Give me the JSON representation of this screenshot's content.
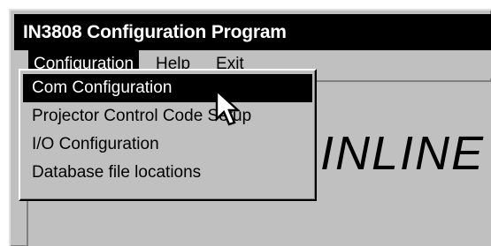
{
  "window": {
    "title": "IN3808 Configuration Program"
  },
  "menubar": {
    "items": [
      {
        "label": "Configuration",
        "accel": "C",
        "rest": "onfiguration"
      },
      {
        "label": "Help",
        "accel": "H",
        "rest": "elp"
      },
      {
        "label": "Exit",
        "accel": "E",
        "rest": "xit"
      }
    ]
  },
  "dropdown": {
    "items": [
      {
        "label": "Com Configuration"
      },
      {
        "label": "Projector Control Code Setup"
      },
      {
        "label": "I/O Configuration"
      },
      {
        "label": "Database file locations"
      }
    ]
  },
  "client": {
    "logo_text": "INLINE"
  },
  "icons": {
    "cursor": "arrow-pointer-icon"
  },
  "colors": {
    "titlebar": "#000000",
    "face": "#c0c0c0",
    "highlight": "#000000"
  }
}
